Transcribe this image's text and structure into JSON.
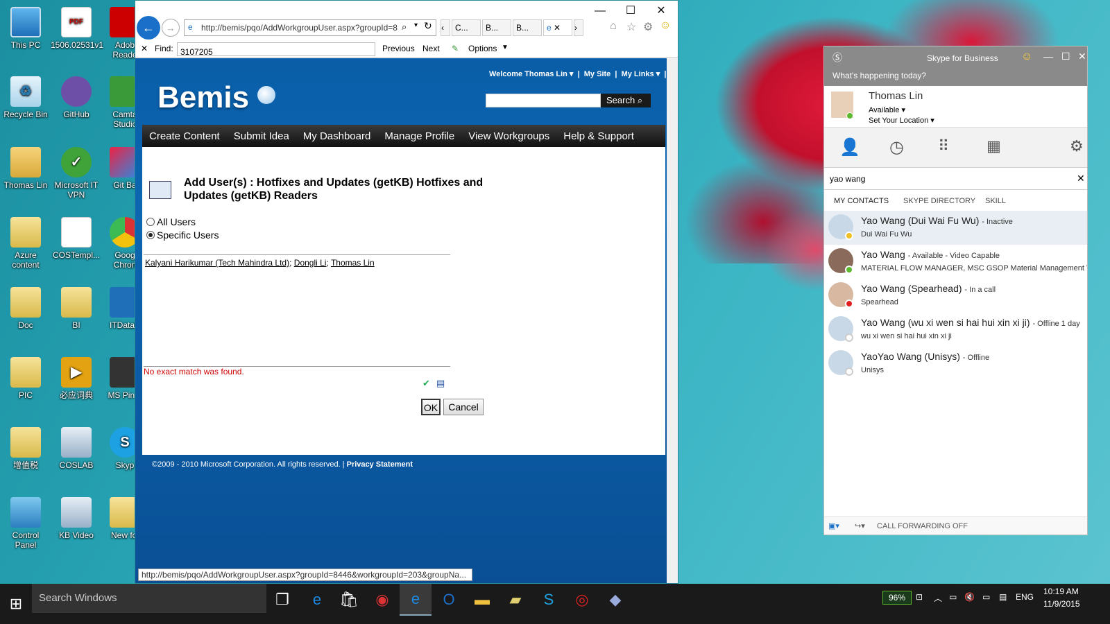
{
  "desktop": {
    "icons": [
      {
        "label": "This PC"
      },
      {
        "label": "1506.02531v1"
      },
      {
        "label": "Adob\nReade"
      },
      {
        "label": "Recycle Bin"
      },
      {
        "label": "GitHub"
      },
      {
        "label": "Camta\nStudic"
      },
      {
        "label": "Thomas Lin"
      },
      {
        "label": "Microsoft IT\nVPN"
      },
      {
        "label": "Git Ba"
      },
      {
        "label": "Azure\ncontent"
      },
      {
        "label": "COSTempl..."
      },
      {
        "label": "Goog\nChron"
      },
      {
        "label": "Doc"
      },
      {
        "label": "BI"
      },
      {
        "label": "ITDataE"
      },
      {
        "label": "PIC"
      },
      {
        "label": "必应词典"
      },
      {
        "label": "MS Pin T"
      },
      {
        "label": "增值税"
      },
      {
        "label": "COSLAB"
      },
      {
        "label": "Skyp"
      },
      {
        "label": "Control\nPanel"
      },
      {
        "label": "KB Video"
      },
      {
        "label": "New fol"
      }
    ],
    "pdf_badge": "PDF"
  },
  "ie": {
    "address": "http://bemis/pqo/AddWorkgroupUser.aspx?groupId=8",
    "tabs": [
      "C...",
      "B...",
      "B..."
    ],
    "find_label": "Find:",
    "find_value": "3107205",
    "find_prev": "Previous",
    "find_next": "Next",
    "find_options": "Options",
    "status_url": "http://bemis/pqo/AddWorkgroupUser.aspx?groupId=8446&workgroupId=203&groupNa..."
  },
  "site": {
    "logo": "Bemis",
    "welcome": "Welcome Thomas Lin",
    "my_site": "My Site",
    "my_links": "My Links",
    "search_btn": "Search",
    "menu": [
      "Create Content",
      "Submit Idea",
      "My Dashboard",
      "Manage Profile",
      "View Workgroups",
      "Help & Support"
    ],
    "page_title": "Add User(s) : Hotfixes and Updates (getKB) Hotfixes and Updates (getKB) Readers",
    "radio_all": "All Users",
    "radio_specific": "Specific Users",
    "people": [
      "Kalyani Harikumar (Tech Mahindra Ltd)",
      "Dongli Li",
      "Thomas Lin"
    ],
    "sep": ";",
    "error": "No exact match was found.",
    "ok": "OK",
    "cancel": "Cancel",
    "copyright": "©2009 - 2010 Microsoft Corporation. All rights reserved.",
    "privacy": "Privacy Statement"
  },
  "skype": {
    "title": "Skype for Business",
    "whats_happening": "What's happening today?",
    "user_name": "Thomas Lin",
    "status": "Available",
    "location": "Set Your Location",
    "search_value": "yao wang",
    "subtabs": [
      "MY CONTACTS",
      "SKYPE DIRECTORY",
      "SKILL"
    ],
    "contacts": [
      {
        "name": "Yao Wang (Dui Wai Fu Wu)",
        "status": "- Inactive",
        "sub": "Dui Wai Fu Wu",
        "pres": "#f0c020"
      },
      {
        "name": "Yao Wang",
        "status": "- Available - Video Capable",
        "sub": "MATERIAL FLOW MANAGER, MSC GSOP Material Management V...",
        "pres": "#5cb82e"
      },
      {
        "name": "Yao Wang (Spearhead)",
        "status": "- In a call",
        "sub": "Spearhead",
        "pres": "#e02020"
      },
      {
        "name": "Yao Wang (wu xi wen si hai hui xin xi ji)",
        "status": "- Offline 1 day",
        "sub": "wu xi wen si hai hui xin xi ji",
        "pres": "#ffffff"
      },
      {
        "name": "YaoYao Wang (Unisys)",
        "status": "- Offline",
        "sub": "Unisys",
        "pres": "#ffffff"
      }
    ],
    "call_forwarding": "CALL FORWARDING OFF"
  },
  "taskbar": {
    "search_placeholder": "Search Windows",
    "battery": "96%",
    "lang": "ENG",
    "time": "10:19 AM",
    "date": "11/9/2015"
  }
}
